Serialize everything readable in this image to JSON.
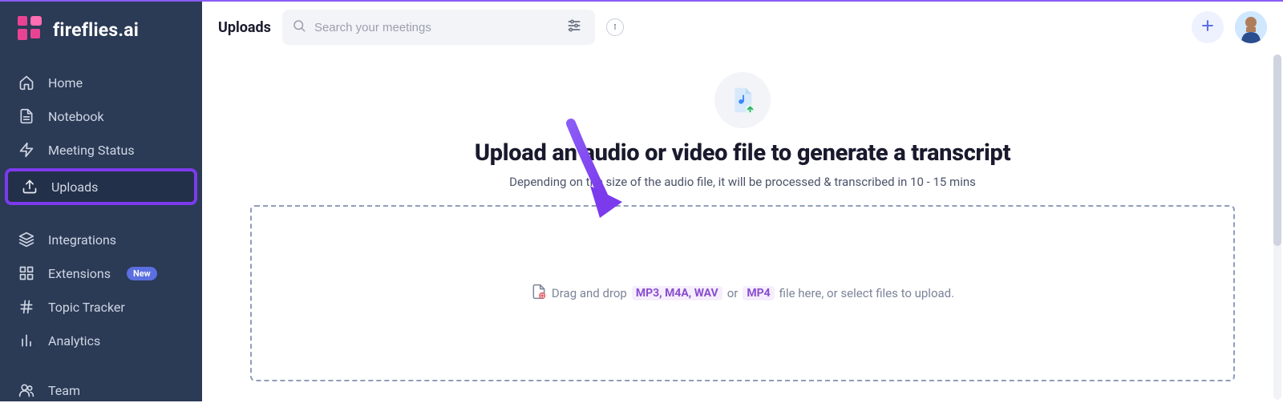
{
  "brand": {
    "name": "fireflies.ai"
  },
  "sidebar": {
    "items": [
      {
        "label": "Home",
        "icon": "home-icon"
      },
      {
        "label": "Notebook",
        "icon": "document-icon"
      },
      {
        "label": "Meeting Status",
        "icon": "bolt-icon"
      },
      {
        "label": "Uploads",
        "icon": "upload-icon",
        "active": true
      }
    ],
    "items2": [
      {
        "label": "Integrations",
        "icon": "layers-icon"
      },
      {
        "label": "Extensions",
        "icon": "grid-icon",
        "badge": "New"
      },
      {
        "label": "Topic Tracker",
        "icon": "hash-icon"
      },
      {
        "label": "Analytics",
        "icon": "bars-icon"
      }
    ],
    "items3": [
      {
        "label": "Team",
        "icon": "team-icon"
      }
    ]
  },
  "header": {
    "title": "Uploads",
    "search_placeholder": "Search your meetings"
  },
  "upload": {
    "title": "Upload an audio or video file to generate a transcript",
    "subtitle": "Depending on the size of the audio file, it will be processed & transcribed in 10 - 15 mins",
    "drop_prefix": "Drag and drop",
    "fmt_audio": "MP3, M4A, WAV",
    "or": "or",
    "fmt_video": "MP4",
    "drop_suffix": "file here, or select files to upload."
  },
  "colors": {
    "sidebar_bg": "#2b3a55",
    "accent": "#7b3fe4",
    "highlight_border": "#7c3aed"
  }
}
